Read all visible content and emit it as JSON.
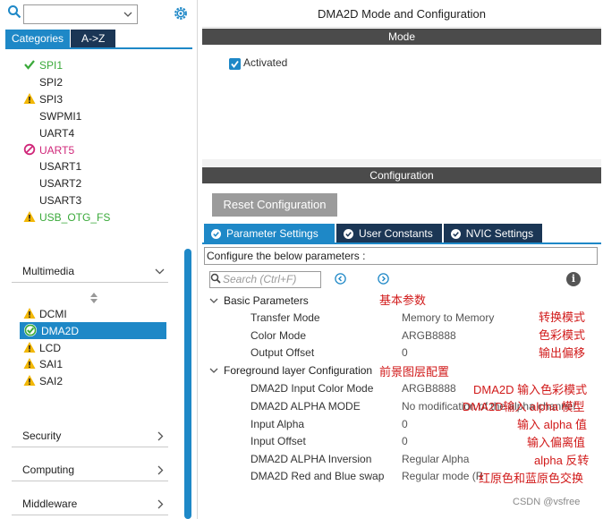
{
  "window_title": "DMA2D Mode and Configuration",
  "left": {
    "search": {
      "value": "",
      "placeholder": ""
    },
    "tabs": [
      {
        "label": "Categories",
        "active": true
      },
      {
        "label": "A->Z",
        "active": false
      }
    ],
    "connectivity_items": [
      {
        "label": "SPI1",
        "status": "ok"
      },
      {
        "label": "SPI2",
        "status": "none"
      },
      {
        "label": "SPI3",
        "status": "warning"
      },
      {
        "label": "SWPMI1",
        "status": "none"
      },
      {
        "label": "UART4",
        "status": "none"
      },
      {
        "label": "UART5",
        "status": "disabled"
      },
      {
        "label": "USART1",
        "status": "none"
      },
      {
        "label": "USART2",
        "status": "none"
      },
      {
        "label": "USART3",
        "status": "none"
      },
      {
        "label": "USB_OTG_FS",
        "status": "warning"
      }
    ],
    "multimedia": {
      "label": "Multimedia",
      "items": [
        {
          "label": "DCMI",
          "status": "warning"
        },
        {
          "label": "DMA2D",
          "status": "ok",
          "selected": true
        },
        {
          "label": "LCD",
          "status": "warning"
        },
        {
          "label": "SAI1",
          "status": "warning"
        },
        {
          "label": "SAI2",
          "status": "warning"
        }
      ]
    },
    "sections": [
      {
        "label": "Security"
      },
      {
        "label": "Computing"
      },
      {
        "label": "Middleware"
      }
    ]
  },
  "mode": {
    "header": "Mode",
    "activated_label": "Activated",
    "activated": true
  },
  "configuration": {
    "header": "Configuration",
    "reset_label": "Reset Configuration",
    "tabs": [
      {
        "label": "Parameter Settings",
        "active": true
      },
      {
        "label": "User Constants",
        "active": false
      },
      {
        "label": "NVIC Settings",
        "active": false
      }
    ],
    "configure_text": "Configure the below parameters :",
    "search_placeholder": "Search (Ctrl+F)",
    "groups": [
      {
        "label": "Basic Parameters",
        "annotation": "基本参数",
        "rows": [
          {
            "label": "Transfer Mode",
            "value": "Memory to Memory",
            "annotation": "转换模式"
          },
          {
            "label": "Color Mode",
            "value": "ARGB8888",
            "annotation": "色彩模式"
          },
          {
            "label": "Output Offset",
            "value": "0",
            "annotation": "输出偏移"
          }
        ]
      },
      {
        "label": "Foreground layer Configuration",
        "annotation": "前景图层配置",
        "rows": [
          {
            "label": "DMA2D Input Color Mode",
            "value": "ARGB8888",
            "annotation": "DMA2D 输入色彩模式"
          },
          {
            "label": "DMA2D ALPHA MODE",
            "value": "No modification of the alpha channel",
            "annotation": "DMA2D输入 alpha 模型"
          },
          {
            "label": "Input Alpha",
            "value": "0",
            "annotation": "输入 alpha 值"
          },
          {
            "label": "Input Offset",
            "value": "0",
            "annotation": "输入偏离值"
          },
          {
            "label": "DMA2D ALPHA Inversion",
            "value": "Regular Alpha",
            "annotation": "alpha 反转"
          },
          {
            "label": "DMA2D Red and Blue swap",
            "value": "Regular mode (RGB or ARGB)",
            "annotation": "红原色和蓝原色交换"
          }
        ]
      }
    ]
  },
  "watermark": "CSDN @vsfree",
  "colors": {
    "accent": "#1e88c7",
    "dark_tab": "#1b3655",
    "bar": "#4b4b4b",
    "annotation": "#d11a1a",
    "ok": "#3aa93a",
    "warning": "#f2b705",
    "disabled": "#d0287a"
  }
}
